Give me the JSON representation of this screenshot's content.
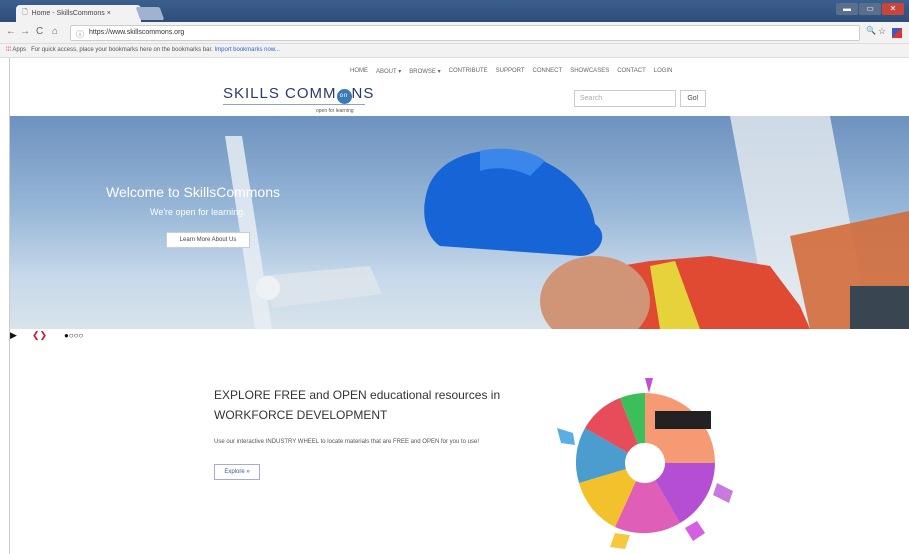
{
  "browser": {
    "tab_title": "Home - SkillsCommons ×",
    "url": "https://www.skillscommons.org",
    "bookmarks_text": "For quick access, place your bookmarks here on the bookmarks bar.",
    "bookmarks_link": "Import bookmarks now...",
    "apps_label": "Apps"
  },
  "site": {
    "nav": [
      "HOME",
      "ABOUT ▾",
      "BROWSE ▾",
      "CONTRIBUTE",
      "SUPPORT",
      "CONNECT",
      "SHOWCASES",
      "CONTACT",
      "LOGIN"
    ],
    "logo_text_a": "SKILLS COMM",
    "logo_text_b": "NS",
    "logo_badge": "on",
    "logo_tagline": "open for learning",
    "search_placeholder": "Search",
    "go_label": "Go!"
  },
  "hero": {
    "title": "Welcome to SkillsCommons",
    "subtitle": "We're open for learning.",
    "button": "Learn More About Us"
  },
  "slider": {
    "prev_next": "❮❯",
    "dots": "●○○○"
  },
  "explore": {
    "line1": "EXPLORE FREE and OPEN educational resources in",
    "line2": "WORKFORCE DEVELOPMENT",
    "description": "Use our interactive INDUSTRY WHEEL to locate materials that are FREE and OPEN for you to use!",
    "button": "Explore »"
  },
  "colors": {
    "brand_blue": "#2b3b6e",
    "link": "#3366cc"
  }
}
